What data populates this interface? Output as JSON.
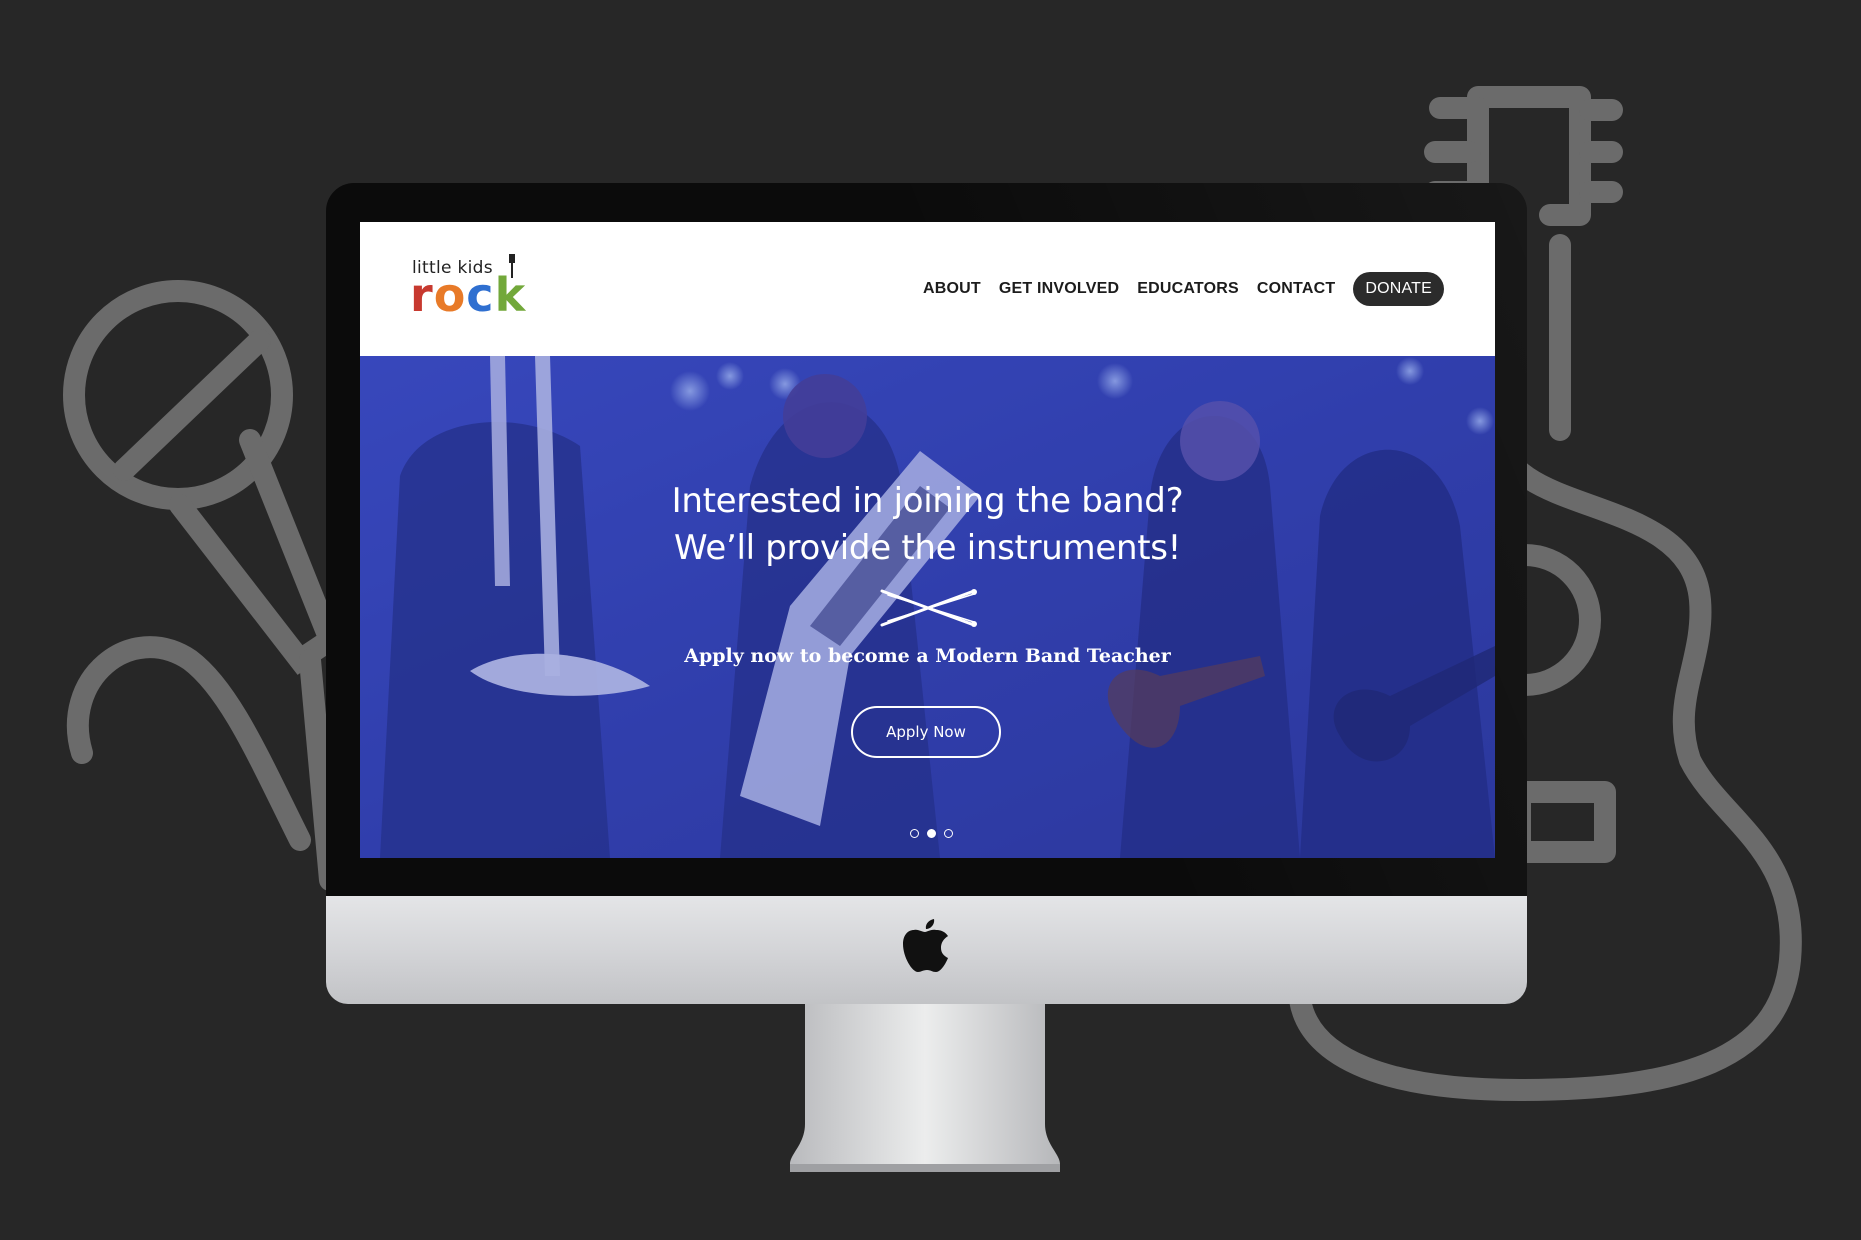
{
  "colors": {
    "page_bg": "#272727",
    "outline_art": "#6b6b6b",
    "hero_tint": "#3442b5",
    "donate_bg": "#2b2b2b",
    "logo_r": "#c7392f",
    "logo_o": "#e87a28",
    "logo_c": "#2f6fd0",
    "logo_k": "#72a83a"
  },
  "logo": {
    "line1": "little kids",
    "letters": [
      "r",
      "o",
      "c",
      "k"
    ]
  },
  "nav": {
    "items": [
      "ABOUT",
      "GET INVOLVED",
      "EDUCATORS",
      "CONTACT"
    ],
    "donate": "DONATE"
  },
  "hero": {
    "title_line1": "Interested in joining the band?",
    "title_line2": "We’ll provide the instruments!",
    "subtitle": "Apply now to become a Modern Band Teacher",
    "cta": "Apply Now",
    "slide_count": 3,
    "active_slide": 2,
    "icon": "drumsticks-icon"
  },
  "decor": {
    "icons": [
      "microphone-icon",
      "guitar-icon",
      "apple-logo-icon"
    ]
  }
}
